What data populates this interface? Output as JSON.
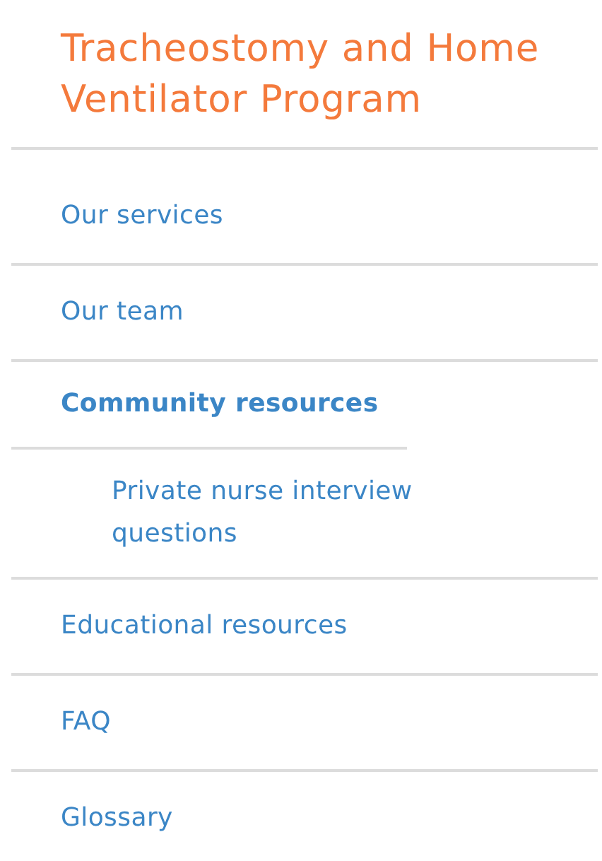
{
  "sidebar": {
    "title": "Tracheostomy and Home Ventilator Program",
    "items": [
      {
        "label": "Our services",
        "selected": false
      },
      {
        "label": "Our team",
        "selected": false
      },
      {
        "label": "Community resources",
        "selected": true,
        "expanded": true,
        "children": [
          {
            "label": "Private nurse interview questions",
            "selected": false
          }
        ]
      },
      {
        "label": "Educational resources",
        "selected": false
      },
      {
        "label": "FAQ",
        "selected": false
      },
      {
        "label": "Glossary",
        "selected": false
      }
    ]
  }
}
